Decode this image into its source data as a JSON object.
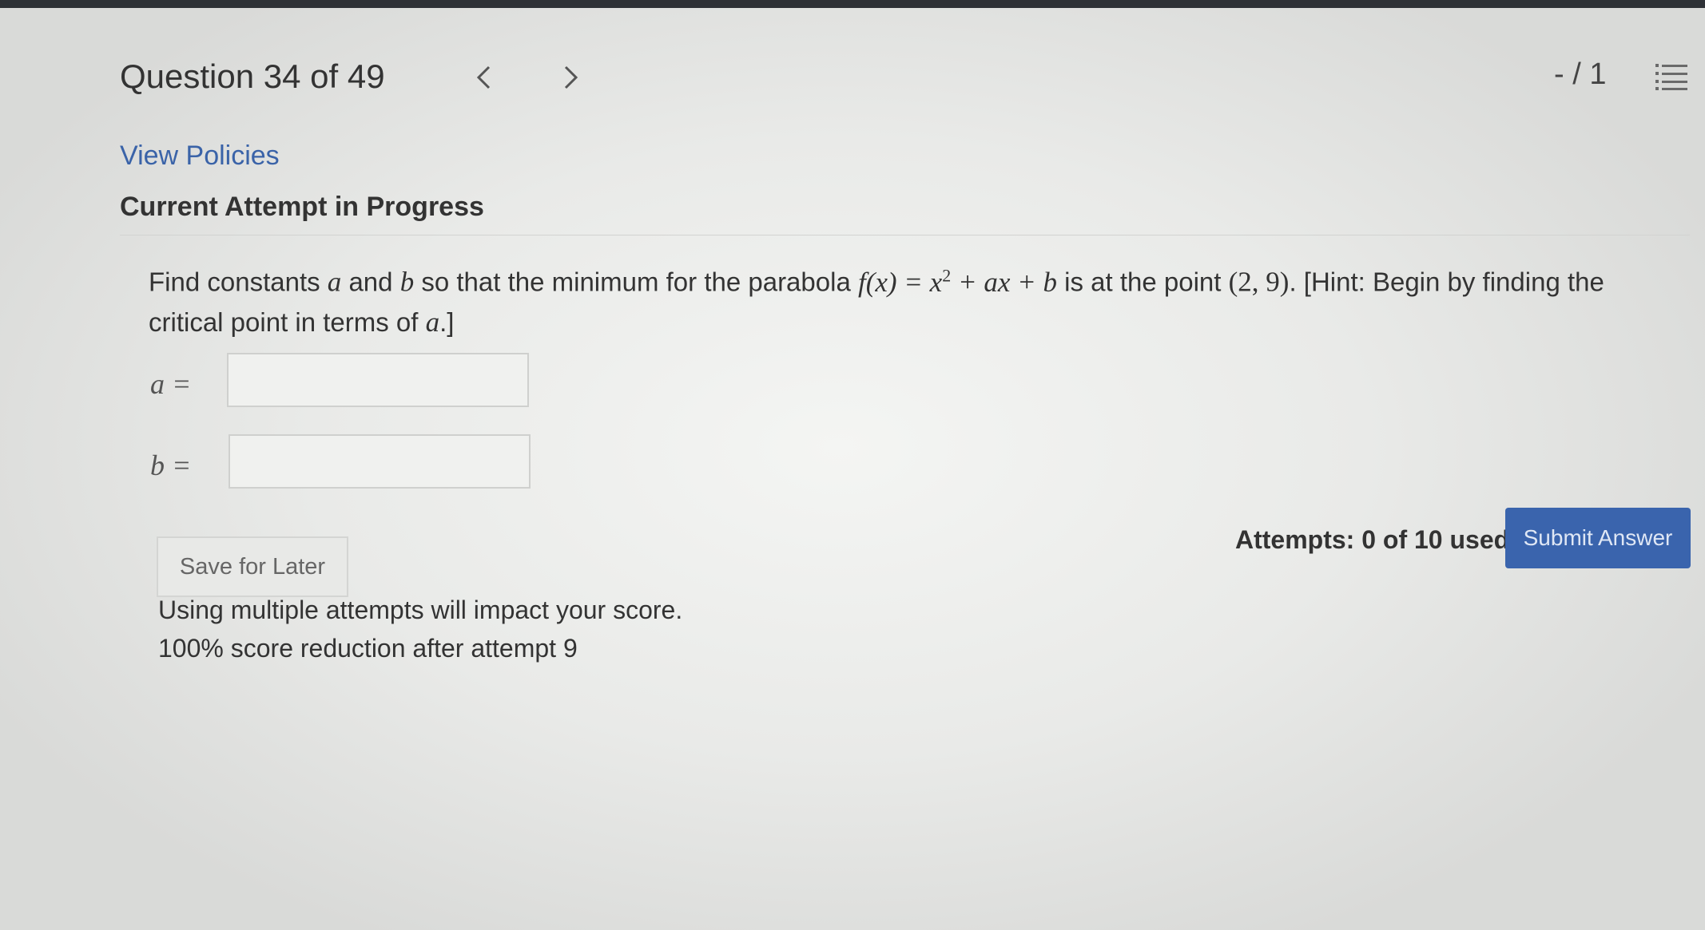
{
  "header": {
    "question_label": "Question 34 of 49",
    "prev_symbol": "<",
    "next_symbol": ">",
    "score": "- / 1",
    "list_icon": "list-icon"
  },
  "links": {
    "view_policies": "View Policies"
  },
  "status": {
    "current_attempt": "Current Attempt in Progress"
  },
  "question": {
    "text_1": "Find constants ",
    "var_a": "a",
    "text_2": " and ",
    "var_b": "b",
    "text_3": " so that the minimum for the parabola ",
    "func": "f(x) = x",
    "exponent": "2",
    "func_rest": " + ax + b",
    "text_4": " is at the point ",
    "point": "(2, 9)",
    "text_5": ". [Hint: Begin by finding the critical point in terms of ",
    "var_a2": "a",
    "text_6": ".]"
  },
  "answers": {
    "a_label": "a =",
    "a_value": "",
    "b_label": "b =",
    "b_value": ""
  },
  "actions": {
    "save_label": "Save for Later",
    "attempts_text": "Attempts: 0 of 10 used",
    "submit_label": "Submit Answer"
  },
  "notices": {
    "line_1": "Using multiple attempts will impact your score.",
    "line_2": "100% score reduction after attempt 9"
  },
  "colors": {
    "link": "#3a63a8",
    "submit_bg": "#3a64ad"
  }
}
